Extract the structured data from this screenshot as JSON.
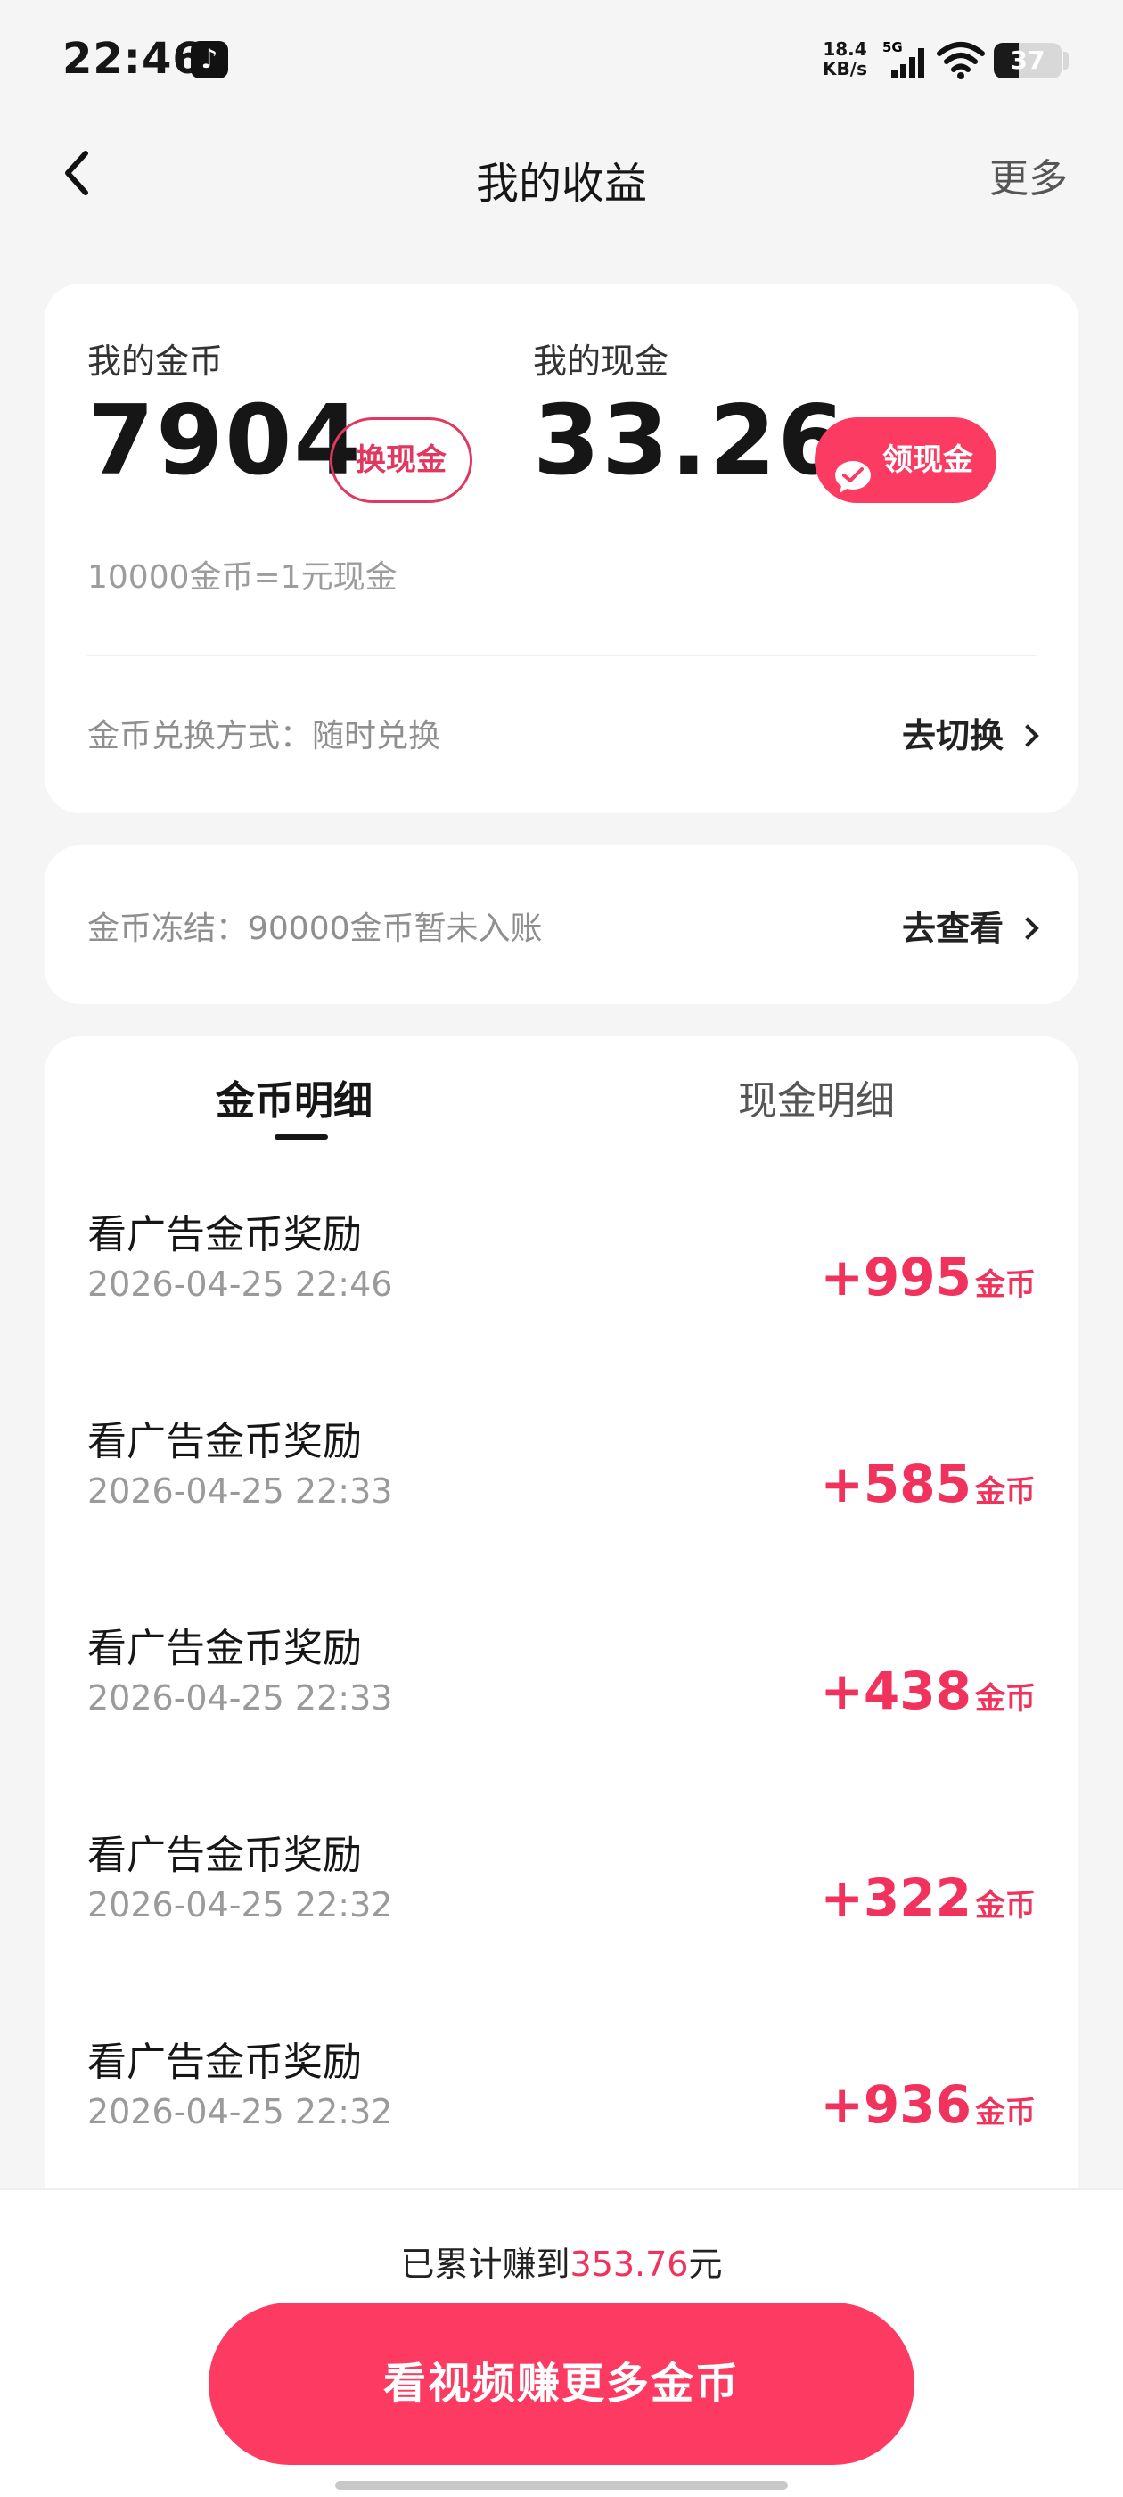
{
  "status_bar": {
    "time": "22:46",
    "app_icon": "tiktok-icon",
    "net_speed_value": "18.4",
    "net_speed_unit": "KB/s",
    "network": "5G",
    "battery": "37",
    "battery_level": 0.37
  },
  "nav": {
    "title": "我的收益",
    "more": "更多",
    "back_icon": "chevron-left-icon"
  },
  "balance": {
    "coins_label": "我的金币",
    "coins_value": "7904",
    "exchange_button": "换现金",
    "cash_label": "我的现金",
    "cash_value": "33.26",
    "claim_button": "领现金",
    "claim_icon": "wechat-icon",
    "rate": "10000金币=1元现金",
    "method": "金币兑换方式：随时兑换",
    "switch_link": "去切换"
  },
  "frozen": {
    "text": "金币冻结：90000金币暂未入账",
    "view_link": "去查看"
  },
  "tabs": {
    "coin_detail": "金币明细",
    "cash_detail": "现金明细",
    "active": "coin_detail"
  },
  "records": [
    {
      "title": "看广告金币奖励",
      "time": "2026-04-25 22:46",
      "amount": "+995",
      "unit": "金币"
    },
    {
      "title": "看广告金币奖励",
      "time": "2026-04-25 22:33",
      "amount": "+585",
      "unit": "金币"
    },
    {
      "title": "看广告金币奖励",
      "time": "2026-04-25 22:33",
      "amount": "+438",
      "unit": "金币"
    },
    {
      "title": "看广告金币奖励",
      "time": "2026-04-25 22:32",
      "amount": "+322",
      "unit": "金币"
    },
    {
      "title": "看广告金币奖励",
      "time": "2026-04-25 22:32",
      "amount": "+936",
      "unit": "金币"
    }
  ],
  "footer": {
    "total_prefix": "已累计赚到",
    "total_amount": "353.76",
    "total_suffix": "元",
    "cta": "看视频赚更多金币"
  },
  "colors": {
    "accent": "#fc3b62",
    "amount": "#f0325d",
    "background": "#f5f5f5"
  }
}
